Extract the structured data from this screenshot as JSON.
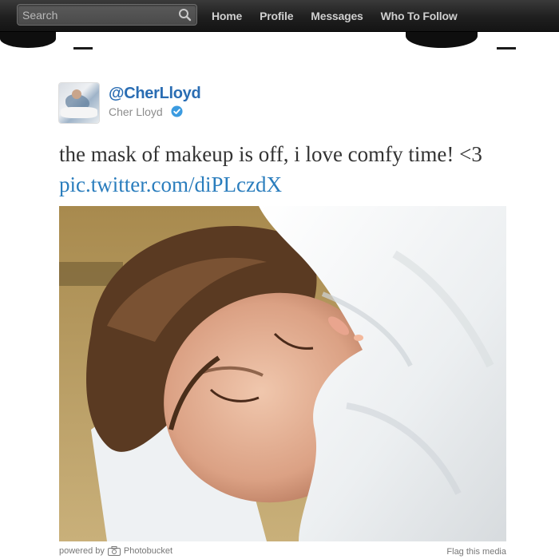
{
  "topbar": {
    "search_placeholder": "Search",
    "nav": [
      "Home",
      "Profile",
      "Messages",
      "Who To Follow"
    ]
  },
  "tweet": {
    "handle": "@CherLloyd",
    "name": "Cher Lloyd",
    "text": "the mask of makeup is off, i love comfy time! <3 ",
    "link": "pic.twitter.com/diPLczdX"
  },
  "media": {
    "powered_by": "powered by",
    "provider": "Photobucket",
    "flag": "Flag this media"
  },
  "colors": {
    "accent": "#2a6db3",
    "link": "#2a7dbd",
    "verified": "#3b9be0"
  }
}
